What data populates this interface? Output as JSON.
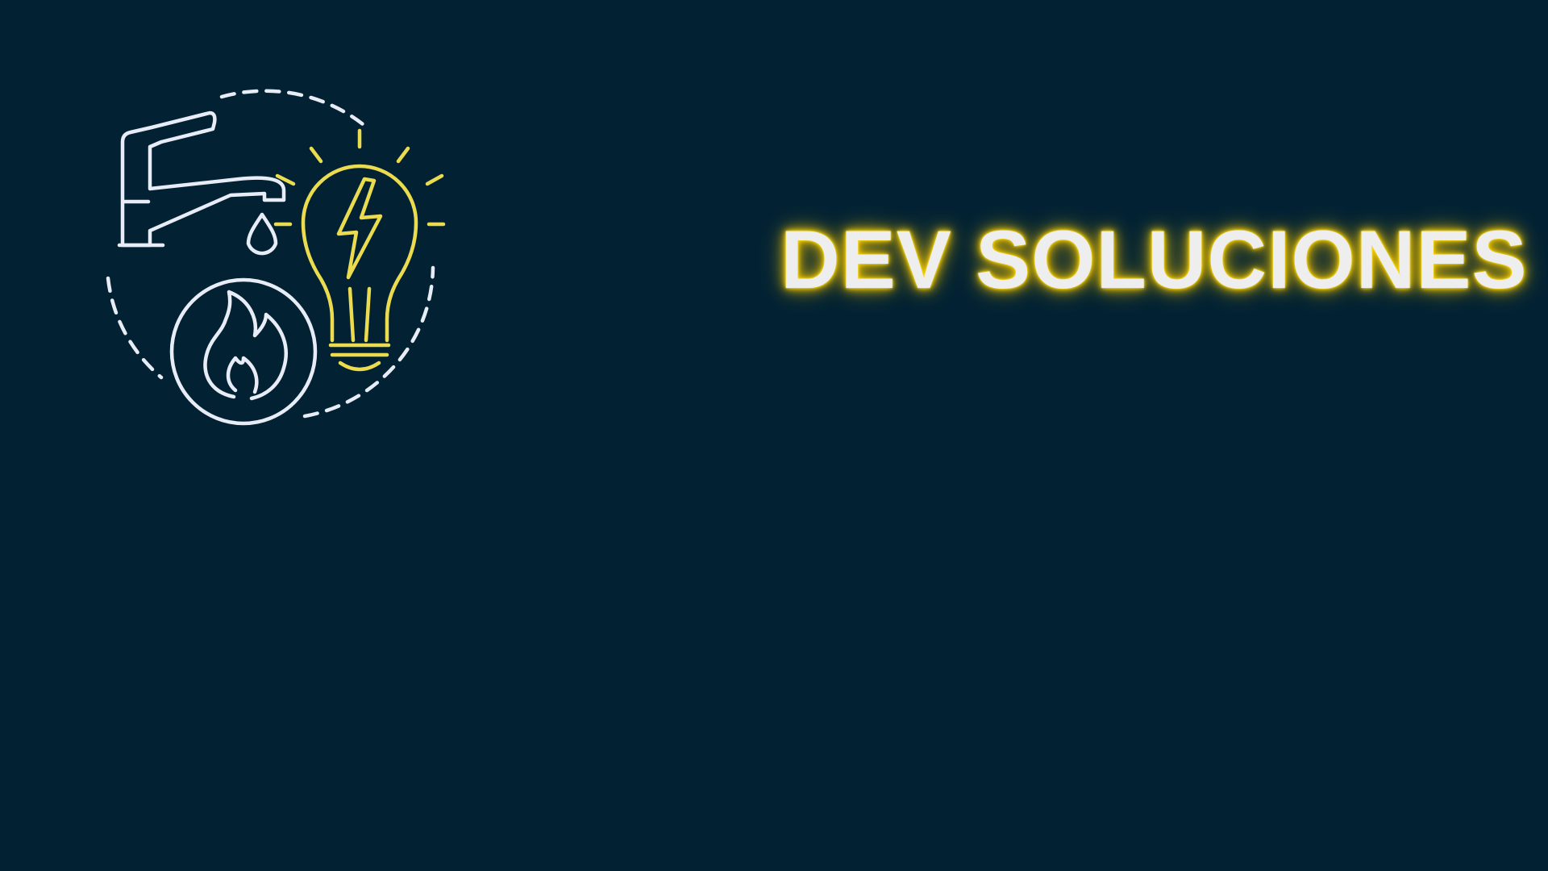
{
  "brand": {
    "title": "DEV SOLUCIONES",
    "logo": {
      "icons": [
        "faucet-icon",
        "water-drop-icon",
        "lightbulb-icon",
        "lightning-icon",
        "flame-icon"
      ]
    }
  },
  "colors": {
    "background": "#022234",
    "line_white": "#e8ecf6",
    "accent_yellow": "#eadb4f",
    "glow_yellow": "#ffd800",
    "title_text": "#eeeeee"
  }
}
